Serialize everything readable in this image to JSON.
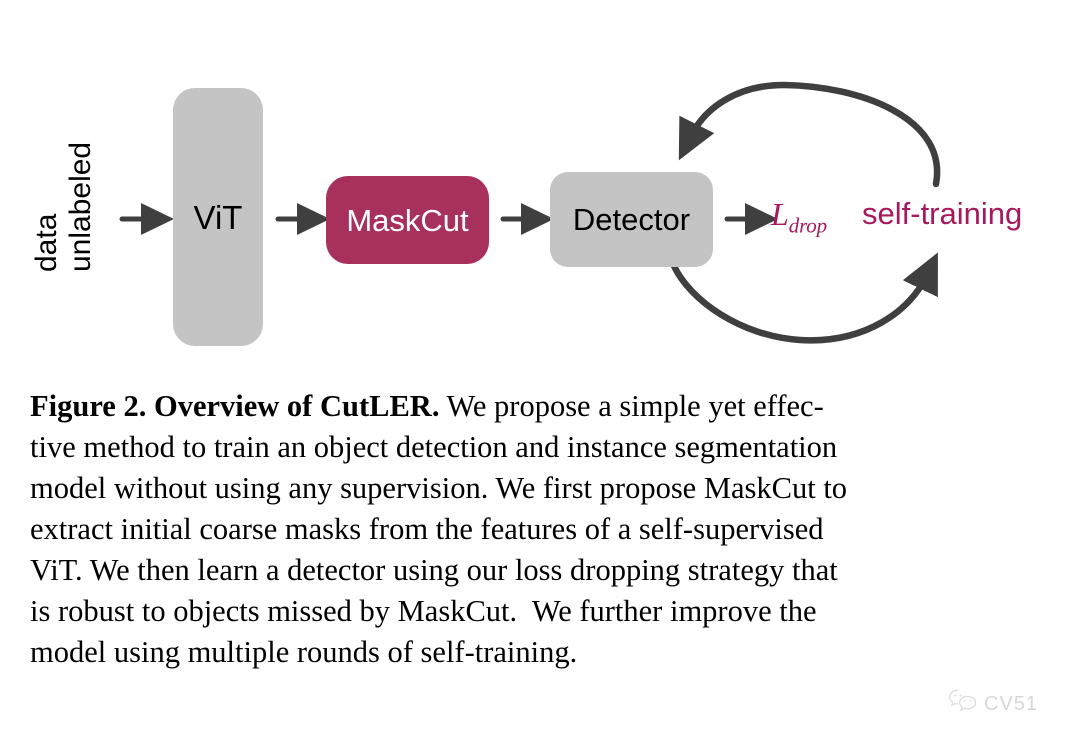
{
  "figure": {
    "diagram": {
      "input": {
        "line1": "unlabeled",
        "line2": "data"
      },
      "nodes": [
        {
          "id": "vit",
          "label": "ViT",
          "fill": "#c4c4c4",
          "text_color": "#000000"
        },
        {
          "id": "maskcut",
          "label": "MaskCut",
          "fill": "#a8305d",
          "text_color": "#ffffff"
        },
        {
          "id": "detector",
          "label": "Detector",
          "fill": "#c4c4c4",
          "text_color": "#000000"
        }
      ],
      "loss": {
        "symbol": "L",
        "subscript": "drop",
        "color": "#a8185c"
      },
      "self_training": {
        "label": "self-training",
        "color": "#a8185c"
      },
      "arrow_color": "#3f3f3f",
      "flow": [
        "unlabeled data",
        "ViT",
        "MaskCut",
        "Detector",
        "L_drop",
        "self-training"
      ],
      "loop_arrows": [
        "self-training to Detector (top arc)",
        "Detector to self-training (bottom arc)"
      ]
    },
    "caption": {
      "title": "Figure 2. Overview of CutLER.",
      "lines": [
        " We propose a simple yet effec-",
        "tive method to train an object detection and instance segmentation",
        "model without using any supervision. We first propose MaskCut to",
        "extract initial coarse masks from the features of a self-supervised",
        "ViT. We then learn a detector using our loss dropping strategy that",
        "is robust to objects missed by MaskCut.  We further improve the",
        "model using multiple rounds of self-training."
      ],
      "full_text": "Figure 2. Overview of CutLER. We propose a simple yet effective method to train an object detection and instance segmentation model without using any supervision. We first propose MaskCut to extract initial coarse masks from the features of a self-supervised ViT. We then learn a detector using our loss dropping strategy that is robust to objects missed by MaskCut. We further improve the model using multiple rounds of self-training."
    },
    "watermark": {
      "icon": "wechat-icon",
      "text": "CV51",
      "color": "#d2d2d2"
    }
  }
}
